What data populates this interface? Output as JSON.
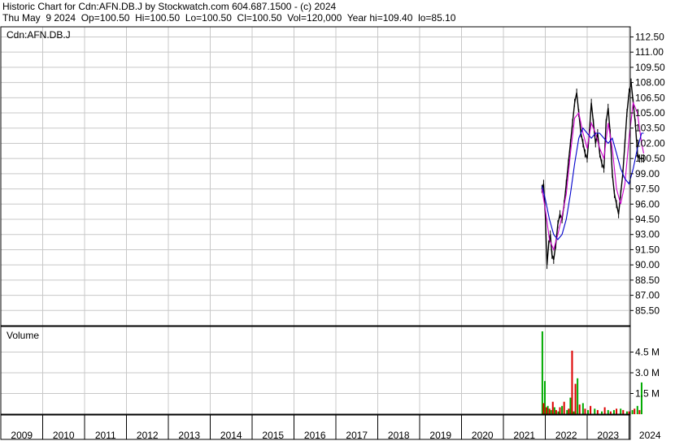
{
  "header": {
    "line1": "Historic Chart for Cdn:AFN.DB.J by Stockwatch.com 604.687.1500 - (c) 2024",
    "line2": "Thu May  9 2024  Op=100.50  Hi=100.50  Lo=100.50  Cl=100.50  Vol=120,000  Year hi=109.40  lo=85.10"
  },
  "chart_data": [
    {
      "type": "line",
      "title": "Cdn:AFN.DB.J",
      "ylabel": "",
      "ylim": [
        84.0,
        113.5
      ],
      "y_ticks": [
        "112.50",
        "111.00",
        "109.50",
        "108.00",
        "106.50",
        "105.00",
        "103.50",
        "102.00",
        "100.50",
        "99.00",
        "97.50",
        "96.00",
        "94.50",
        "93.00",
        "91.50",
        "90.00",
        "88.50",
        "87.00",
        "85.50"
      ],
      "x_ticks": [
        "2009",
        "2010",
        "2011",
        "2012",
        "2013",
        "2014",
        "2015",
        "2016",
        "2017",
        "2018",
        "2019",
        "2020",
        "2021",
        "2022",
        "2023",
        "2024"
      ],
      "grid": true,
      "series": [
        {
          "color": "#000000",
          "x": [
            2021.92,
            2021.96,
            2022.0,
            2022.04,
            2022.08,
            2022.12,
            2022.16,
            2022.2,
            2022.25,
            2022.3,
            2022.35,
            2022.4,
            2022.45,
            2022.5,
            2022.55,
            2022.6,
            2022.65,
            2022.7,
            2022.75,
            2022.8,
            2022.85,
            2022.9,
            2022.95,
            2023.0,
            2023.05,
            2023.1,
            2023.15,
            2023.2,
            2023.25,
            2023.3,
            2023.35,
            2023.4,
            2023.45,
            2023.5,
            2023.55,
            2023.6,
            2023.65,
            2023.7,
            2023.75,
            2023.8,
            2023.85,
            2023.9,
            2023.95,
            2024.0,
            2024.05,
            2024.1,
            2024.15,
            2024.2,
            2024.25,
            2024.3,
            2024.35
          ],
          "values": [
            97.5,
            98.0,
            95.0,
            90.0,
            92.0,
            93.0,
            91.0,
            90.5,
            92.0,
            94.0,
            95.0,
            94.5,
            96.0,
            98.0,
            100.0,
            102.0,
            104.0,
            106.0,
            107.0,
            105.0,
            103.0,
            102.0,
            101.0,
            100.5,
            103.0,
            106.0,
            104.0,
            102.0,
            103.0,
            101.0,
            100.0,
            99.5,
            104.0,
            105.5,
            103.0,
            99.0,
            97.0,
            96.0,
            95.0,
            97.0,
            99.0,
            102.0,
            105.0,
            107.0,
            108.0,
            106.0,
            104.0,
            101.0,
            100.5,
            100.5,
            100.5
          ]
        },
        {
          "color": "#cc00cc",
          "x": [
            2021.92,
            2022.0,
            2022.1,
            2022.2,
            2022.3,
            2022.4,
            2022.5,
            2022.6,
            2022.7,
            2022.8,
            2022.9,
            2023.0,
            2023.1,
            2023.2,
            2023.3,
            2023.4,
            2023.5,
            2023.6,
            2023.7,
            2023.8,
            2023.9,
            2024.0,
            2024.1,
            2024.2,
            2024.3,
            2024.35
          ],
          "values": [
            97.5,
            95.5,
            92.5,
            91.5,
            93.0,
            94.8,
            97.0,
            101.0,
            104.5,
            105.0,
            103.0,
            101.5,
            104.0,
            103.0,
            101.5,
            100.5,
            104.0,
            101.5,
            97.5,
            96.0,
            98.0,
            102.5,
            106.0,
            105.0,
            102.0,
            101.0
          ]
        },
        {
          "color": "#0000cc",
          "x": [
            2021.92,
            2022.0,
            2022.1,
            2022.2,
            2022.3,
            2022.4,
            2022.5,
            2022.6,
            2022.7,
            2022.8,
            2022.9,
            2023.0,
            2023.1,
            2023.2,
            2023.3,
            2023.4,
            2023.5,
            2023.6,
            2023.7,
            2023.8,
            2023.9,
            2024.0,
            2024.1,
            2024.2,
            2024.3,
            2024.35
          ],
          "values": [
            97.8,
            96.5,
            94.5,
            93.0,
            92.5,
            93.0,
            94.5,
            97.0,
            100.0,
            102.5,
            103.5,
            103.0,
            102.5,
            103.0,
            103.0,
            102.5,
            102.0,
            102.5,
            101.0,
            99.5,
            98.5,
            98.0,
            99.5,
            101.5,
            103.0,
            103.0
          ]
        }
      ]
    },
    {
      "type": "bar",
      "title": "Volume",
      "ylabel": "",
      "ylim": [
        0,
        6.0
      ],
      "y_ticks": [
        "4.5 M",
        "3.0 M",
        "1.5 M"
      ],
      "grid": true,
      "series": [
        {
          "name": "",
          "color": "#00aa00",
          "x": [
            2021.93,
            2021.99,
            2022.06,
            2022.14,
            2022.22,
            2022.31,
            2022.4,
            2022.52,
            2022.6,
            2022.68,
            2022.77,
            2022.9,
            2023.02,
            2023.18,
            2023.35,
            2023.5,
            2023.64,
            2023.8,
            2023.95,
            2024.08,
            2024.2,
            2024.3
          ],
          "values": [
            6.0,
            2.4,
            0.6,
            0.3,
            0.5,
            0.2,
            0.6,
            0.3,
            1.2,
            0.2,
            2.6,
            0.8,
            0.3,
            0.4,
            0.2,
            0.3,
            0.3,
            0.4,
            0.2,
            0.3,
            0.6,
            2.3
          ]
        },
        {
          "name": "",
          "color": "#dd0000",
          "x": [
            2021.96,
            2022.03,
            2022.1,
            2022.18,
            2022.26,
            2022.35,
            2022.45,
            2022.56,
            2022.64,
            2022.72,
            2022.82,
            2022.95,
            2023.08,
            2023.25,
            2023.42,
            2023.56,
            2023.7,
            2023.86,
            2024.0,
            2024.13,
            2024.25
          ],
          "values": [
            0.8,
            0.5,
            0.4,
            0.9,
            0.3,
            0.5,
            0.9,
            0.4,
            4.6,
            2.2,
            0.7,
            0.4,
            0.6,
            0.3,
            0.5,
            0.2,
            0.4,
            0.3,
            0.2,
            0.4,
            0.3
          ]
        }
      ]
    }
  ]
}
